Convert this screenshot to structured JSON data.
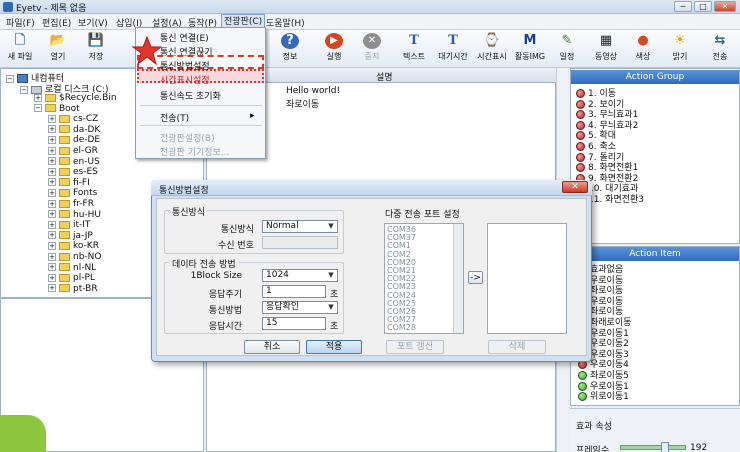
{
  "window": {
    "title": "Eyetv - 제목 없음",
    "buttons": [
      "─",
      "□",
      "✕"
    ]
  },
  "menubar": [
    "파일(F)",
    "편집(E)",
    "보기(V)",
    "삽입(I)",
    "설정(A)",
    "동작(P)",
    "전광판(C)",
    "도움말(H)"
  ],
  "toolbar": {
    "left": [
      {
        "label": "새 파일",
        "icon": "new-file-icon",
        "glyph": "🗋"
      },
      {
        "label": "열기",
        "icon": "open-folder-icon",
        "glyph": "📂"
      },
      {
        "label": "저장",
        "icon": "save-icon",
        "glyph": "💾"
      }
    ],
    "right": [
      {
        "label": "정보",
        "icon": "info-icon",
        "glyph": "?"
      },
      {
        "label": "실행",
        "icon": "run-icon",
        "glyph": "▶"
      },
      {
        "label": "중지",
        "icon": "stop-icon",
        "glyph": "✕"
      },
      {
        "label": "텍스트",
        "icon": "text-icon",
        "glyph": "T"
      },
      {
        "label": "대기시간",
        "icon": "wait-time-icon",
        "glyph": "T"
      },
      {
        "label": "시간표시",
        "icon": "clock-display-icon",
        "glyph": "⌚"
      },
      {
        "label": "활동IMG",
        "icon": "activity-img-icon",
        "glyph": "M"
      },
      {
        "label": "일정",
        "icon": "schedule-icon",
        "glyph": "✎"
      },
      {
        "label": "동영상",
        "icon": "video-icon",
        "glyph": "▦"
      },
      {
        "label": "색상",
        "icon": "color-icon",
        "glyph": "●"
      },
      {
        "label": "밝기",
        "icon": "brightness-icon",
        "glyph": "☀"
      },
      {
        "label": "전송",
        "icon": "send-icon",
        "glyph": "⇆"
      }
    ]
  },
  "tree": {
    "root": "내컴퓨터",
    "drive": "로컬 디스크 (C:)",
    "items": [
      "$Recycle.Bin",
      "Boot",
      "cs-CZ",
      "da-DK",
      "de-DE",
      "el-GR",
      "en-US",
      "es-ES",
      "fi-FI",
      "Fonts",
      "fr-FR",
      "hu-HU",
      "it-IT",
      "ja-JP",
      "ko-KR",
      "nb-NO",
      "nl-NL",
      "pl-PL",
      "pt-BR"
    ]
  },
  "center": {
    "header": "설명",
    "rows": [
      "Hello world!",
      "좌로이동"
    ]
  },
  "action_group": {
    "title": "Action Group",
    "items": [
      "1. 이동",
      "2. 보이기",
      "3. 무늬효과1",
      "4. 무늬효과2",
      "5. 확대",
      "6. 축소",
      "7. 돌리기",
      "8. 화면전환1",
      "9. 화면전환2",
      "10. 대기효과",
      "11. 화면전환3"
    ]
  },
  "action_item": {
    "title": "Action Item",
    "items": [
      "효과없음",
      "우로이동",
      "좌로이동",
      "우로이동",
      "좌로이동",
      "좌래로이동",
      "우로이동1",
      "우로이동2",
      "우로이동3",
      "우로이동4",
      "좌로이동5",
      "우로이동1",
      "위로이동1"
    ]
  },
  "effect": {
    "title": "효과 속성",
    "frame_label": "프레임수",
    "frame_value": "192"
  },
  "menu": {
    "items": [
      "통신 연결(E)",
      "통신 연결끊기",
      "통신방법설정",
      "시간표시설정",
      "통신속도 초기화",
      "전송(T)",
      "전광판설정(B)",
      "전광판 기기정보..."
    ],
    "disabled": [
      false,
      false,
      false,
      false,
      false,
      false,
      true,
      true
    ],
    "submenu_arrow": "▸"
  },
  "dialog": {
    "title": "통신방법설정",
    "comm_group": "통신방식",
    "comm_method_label": "통신방식",
    "comm_method_value": "Normal",
    "recv_no_label": "수신 번호",
    "data_group": "데이타 전송 방법",
    "block_size_label": "1Block Size",
    "block_size_value": "1024",
    "resp_cycle_label": "응답주기",
    "resp_cycle_value": "1",
    "resp_cycle_unit": "초",
    "comm_way_label": "통신방법",
    "comm_way_value": "응답확인",
    "resp_time_label": "응답시간",
    "resp_time_value": "15",
    "resp_time_unit": "초",
    "multi_port_group": "다중 전송 포트 설정",
    "ports": [
      "COM36",
      "COM37",
      "COM1",
      "COM2",
      "COM20",
      "COM21",
      "COM22",
      "COM23",
      "COM24",
      "COM25",
      "COM26",
      "COM27",
      "COM28"
    ],
    "move_button": "->",
    "cancel_button": "취소",
    "apply_button": "적용",
    "port_refresh_button": "포트 갱신",
    "delete_button": "삭제"
  },
  "colors": {
    "accent": "#2f6cc0",
    "highlight": "#e2342a",
    "green": "#8dc63f"
  }
}
